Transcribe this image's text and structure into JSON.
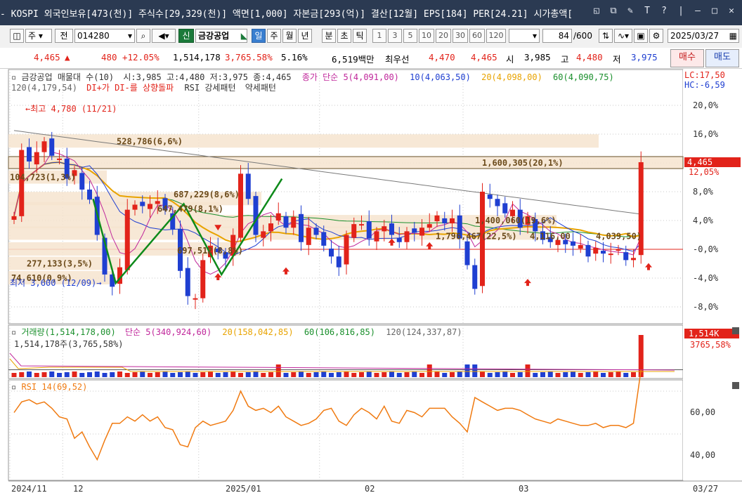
{
  "titlebar": {
    "text": "- KOSPI 외국인보유[473(천)] 주식수[29,329(천)] 액면[1,000] 자본금[293(억)] 결산[12월] EPS[184] PER[24.21] 시가총액[",
    "icons": [
      "window-restore-icon",
      "copy-icon",
      "pin-icon",
      "font-icon",
      "help-icon",
      "separator",
      "minimize-icon",
      "maximize-icon",
      "close-icon"
    ]
  },
  "toolbar": {
    "mode1": "주",
    "mode2": "전",
    "code": "014280",
    "badge": "신",
    "name": "금강공업",
    "periods": [
      "일",
      "주",
      "월",
      "년",
      "분",
      "초",
      "틱"
    ],
    "active_period": "일",
    "intervals": [
      "1",
      "3",
      "5",
      "10",
      "20",
      "30",
      "60",
      "120"
    ],
    "count": "84",
    "count_max": "/600",
    "date": "2025/03/27"
  },
  "quote": {
    "price": "4,465",
    "arrow": "▲",
    "change": "480",
    "change_pct": "+12.05%",
    "volume": "1,514,178",
    "volume_ratio": "3,765.58%",
    "turnover": "5.16%",
    "amount": "6,519백만",
    "best_ask_label": "최우선",
    "ask": "4,470",
    "bid": "4,465",
    "open_label": "시",
    "open": "3,985",
    "high_label": "고",
    "high": "4,480",
    "low_label": "저",
    "low": "3,975",
    "buy_label": "매수",
    "sell_label": "매도"
  },
  "colors": {
    "up": "#e2231a",
    "down": "#1f3fd1",
    "ma5": "#c0279b",
    "ma10": "#1f3fd1",
    "ma20": "#e8a300",
    "ma60": "#1a8f2c",
    "ma120": "#7a7a7a",
    "rsi": "#f07a10",
    "zigzag": "#0e8a1a",
    "band": "#f6e4cf"
  },
  "price_panel": {
    "legend_line1": {
      "name": "금강공업 매물대 수(10)",
      "ohlc": "시:3,985 고:4,480 저:3,975 종:4,465",
      "ma_title": "종가 단순 5(4,091,00)",
      "ma10": "10(4,063,50)",
      "ma20": "20(4,098,00)",
      "ma60": "60(4,090,75)"
    },
    "legend_line2": {
      "ma120": "120(4,179,54)",
      "signal": "DI+가 DI-를 상향돌파",
      "rsi_pattern": "RSI 강세패턴",
      "weak_pattern": "약세패턴"
    },
    "lc": "LC:17,50",
    "hc": "HC:-6,59",
    "y_ticks": [
      "20,0%",
      "16,0%",
      "12,0%",
      "8,0%",
      "4,0%",
      "-0,0%",
      "-4,0%",
      "-8,0%"
    ],
    "y_tick_values": [
      20,
      16,
      12,
      8,
      4,
      0,
      -4,
      -8
    ],
    "last_price_tag": "4,465",
    "last_pct_tag": "12,05%",
    "high_note": "최고 4,780 (11/21)",
    "low_note": "최저 3,600 (12/09)",
    "volume_profile": [
      {
        "label": "528,786(6,6%)",
        "pct": 15.0
      },
      {
        "label": "1,600,305(20,1%)",
        "pct": 12.0
      },
      {
        "label": "104,723(1,3%)",
        "pct": 10.0
      },
      {
        "label": "687,229(8,6%)",
        "pct": 7.0
      },
      {
        "label": "647,479(8,1%)",
        "pct": 5.6
      },
      {
        "label": "1,796,467(22,5%)",
        "pct": 2.2
      },
      {
        "label": "1,400,060(19,6%)",
        "pct": 3.8
      },
      {
        "label": "4,116,00",
        "pct": 2.0
      },
      {
        "label": "4,039,50)",
        "pct": 2.0
      },
      {
        "label": "697,512(8,8%)",
        "pct": 0.0
      },
      {
        "label": "277,133(3,5%)",
        "pct": -2.0
      },
      {
        "label": "74,610(0,9%)",
        "pct": -4.0
      }
    ]
  },
  "volume_panel": {
    "legend": {
      "title": "거래량(1,514,178,00)",
      "ma5": "단순 5(340,924,60)",
      "ma20": "20(158,042,85)",
      "ma60": "60(106,816,85)",
      "ma120": "120(124,337,87)"
    },
    "sub": "1,514,178주(3,765,58%)",
    "tag_value": "1,514K",
    "tag_pct": "3765,58%"
  },
  "rsi_panel": {
    "legend": "RSI 14(69,52)",
    "y_ticks": [
      "60,00",
      "40,00"
    ],
    "y_tick_values": [
      60,
      40
    ]
  },
  "x_axis": {
    "labels": [
      {
        "text": "2024/11",
        "idx": 0
      },
      {
        "text": "12",
        "idx": 7
      },
      {
        "text": "2025/01",
        "idx": 25
      },
      {
        "text": "02",
        "idx": 41
      },
      {
        "text": "03",
        "idx": 60
      }
    ],
    "cursor_date": "03/27"
  },
  "chart_data": {
    "type": "line",
    "title": "금강공업 매물대 수(10)",
    "y_unit": "%",
    "ylim": [
      -10,
      22
    ],
    "series": [
      {
        "name": "종가",
        "values": [
          4.6,
          13.8,
          12.2,
          13.5,
          15.0,
          13.0,
          12.6,
          9.8,
          11.0,
          8.3,
          6.9,
          2.0,
          -3.5,
          -5.2,
          -2.5,
          5.5,
          6.2,
          6.0,
          6.3,
          6.7,
          5.4,
          2.8,
          -3.0,
          -6.5,
          -6.8,
          -1.5,
          0.5,
          -0.4,
          -1.3,
          2.0,
          10.5,
          7.0,
          2.0,
          2.5,
          3.6,
          5.0,
          3.0,
          4.5,
          1.0,
          3.0,
          2.0,
          0.5,
          -1.0,
          -2.5,
          2.0,
          3.5,
          3.5,
          1.5,
          2.5,
          3.2,
          2.0,
          1.0,
          2.5,
          2.3,
          3.0,
          3.5,
          4.7,
          3.6,
          4.3,
          1.5,
          -2.2,
          -5.5,
          8.0,
          7.0,
          6.0,
          5.0,
          5.5,
          3.0,
          4.6,
          2.5,
          1.3,
          1.0,
          1.3,
          0.7,
          0.5,
          0.6,
          -1.0,
          0.2,
          -0.6,
          -0.6,
          0.0,
          -1.5,
          -1.2,
          12.1
        ]
      },
      {
        "name": "RSI 14",
        "values": [
          50,
          55,
          56,
          54,
          55,
          52,
          48,
          47,
          38,
          41,
          34,
          28,
          37,
          45,
          45,
          48,
          46,
          49,
          46,
          48,
          43,
          42,
          35,
          34,
          43,
          46,
          44,
          45,
          46,
          51,
          60,
          53,
          51,
          52,
          50,
          53,
          48,
          46,
          44,
          45,
          47,
          51,
          52,
          46,
          44,
          49,
          52,
          50,
          47,
          53,
          46,
          45,
          51,
          50,
          48,
          52,
          52,
          52,
          48,
          45,
          41,
          57,
          55,
          53,
          51,
          52,
          52,
          51,
          49,
          47,
          46,
          45,
          47,
          46,
          45,
          44,
          44,
          45,
          43,
          44,
          44,
          43,
          45,
          70
        ]
      }
    ]
  }
}
